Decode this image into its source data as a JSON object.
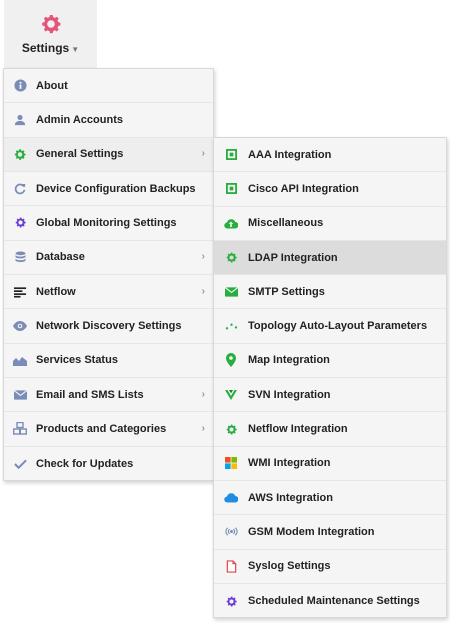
{
  "header": {
    "settings_label": "Settings"
  },
  "colors": {
    "gear_pink": "#e5547b",
    "primary_green": "#27ae3f",
    "purple": "#6a3fd6",
    "blue_gray": "#7b8cb8",
    "highlight": "#dcdcdc"
  },
  "main_menu": {
    "items": [
      {
        "label": "About",
        "icon": "info-icon",
        "has_submenu": false
      },
      {
        "label": "Admin Accounts",
        "icon": "user-icon",
        "has_submenu": false
      },
      {
        "label": "General Settings",
        "icon": "gear-icon",
        "has_submenu": true
      },
      {
        "label": "Device Configuration Backups",
        "icon": "refresh-icon",
        "has_submenu": false
      },
      {
        "label": "Global Monitoring Settings",
        "icon": "gear-icon",
        "has_submenu": false
      },
      {
        "label": "Database",
        "icon": "database-icon",
        "has_submenu": true
      },
      {
        "label": "Netflow",
        "icon": "list-icon",
        "has_submenu": true
      },
      {
        "label": "Network Discovery Settings",
        "icon": "eye-icon",
        "has_submenu": false
      },
      {
        "label": "Services Status",
        "icon": "area-chart-icon",
        "has_submenu": false
      },
      {
        "label": "Email and SMS Lists",
        "icon": "envelope-icon",
        "has_submenu": true
      },
      {
        "label": "Products and Categories",
        "icon": "cubes-icon",
        "has_submenu": true
      },
      {
        "label": "Check for Updates",
        "icon": "check-icon",
        "has_submenu": false
      }
    ]
  },
  "sub_menu": {
    "items": [
      {
        "label": "AAA Integration",
        "icon": "square-icon"
      },
      {
        "label": "Cisco API Integration",
        "icon": "square-icon"
      },
      {
        "label": "Miscellaneous",
        "icon": "cloud-up-icon"
      },
      {
        "label": "LDAP Integration",
        "icon": "gear-icon"
      },
      {
        "label": "SMTP Settings",
        "icon": "envelope-icon"
      },
      {
        "label": "Topology Auto-Layout Parameters",
        "icon": "dots-icon"
      },
      {
        "label": "Map Integration",
        "icon": "map-marker-icon"
      },
      {
        "label": "SVN Integration",
        "icon": "vue-icon"
      },
      {
        "label": "Netflow Integration",
        "icon": "gear-icon"
      },
      {
        "label": "WMI Integration",
        "icon": "windows-icon"
      },
      {
        "label": "AWS Integration",
        "icon": "cloud-icon"
      },
      {
        "label": "GSM Modem Integration",
        "icon": "fingerprint-icon"
      },
      {
        "label": "Syslog Settings",
        "icon": "file-icon"
      },
      {
        "label": "Scheduled Maintenance Settings",
        "icon": "gear-icon"
      }
    ]
  }
}
